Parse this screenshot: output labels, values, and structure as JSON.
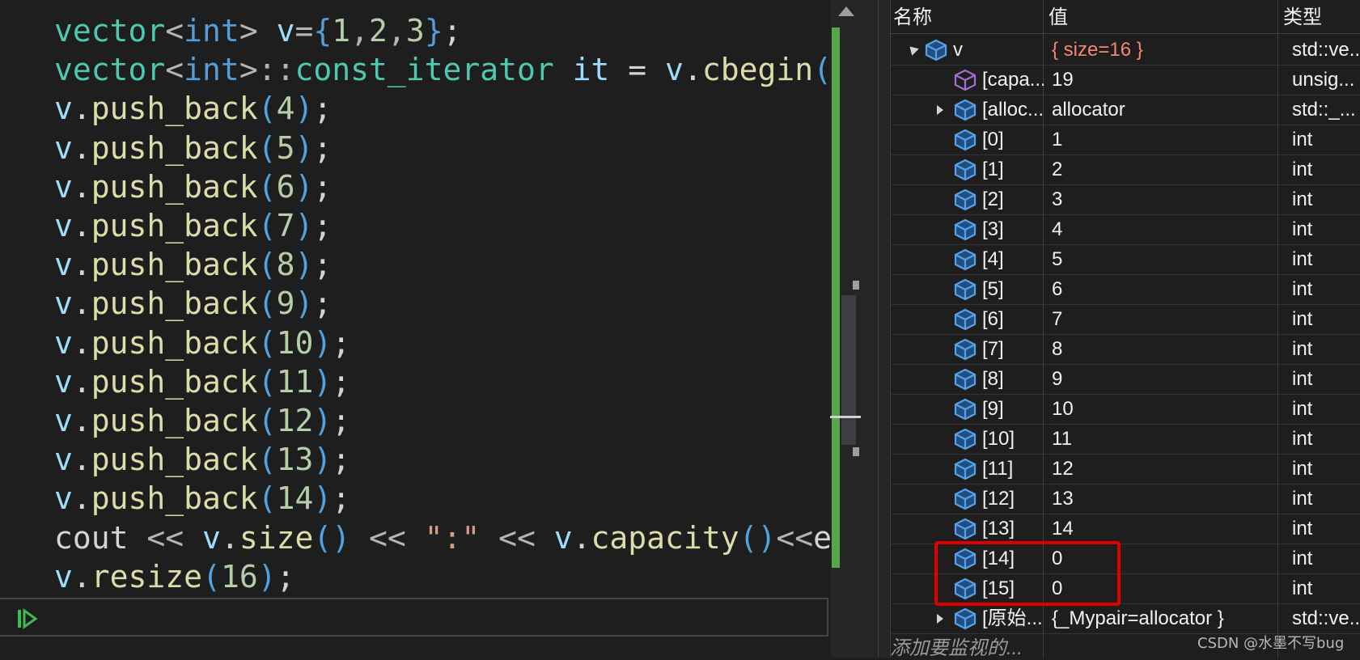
{
  "editor": {
    "lines": [
      [
        [
          "tok-type",
          "vector"
        ],
        [
          "tok-op",
          "<"
        ],
        [
          "tok-kw",
          "int"
        ],
        [
          "tok-op",
          "> "
        ],
        [
          "tok-var",
          "v"
        ],
        [
          "tok-op",
          "="
        ],
        [
          "tok-brace",
          "{"
        ],
        [
          "tok-num",
          "1"
        ],
        [
          "tok-op",
          ","
        ],
        [
          "tok-num",
          "2"
        ],
        [
          "tok-op",
          ","
        ],
        [
          "tok-num",
          "3"
        ],
        [
          "tok-brace",
          "}"
        ],
        [
          "tok-plain",
          ";"
        ]
      ],
      [
        [
          "tok-type",
          "vector"
        ],
        [
          "tok-op",
          "<"
        ],
        [
          "tok-kw",
          "int"
        ],
        [
          "tok-op",
          ">::"
        ],
        [
          "tok-type",
          "const_iterator"
        ],
        [
          "tok-plain",
          " "
        ],
        [
          "tok-var",
          "it"
        ],
        [
          "tok-plain",
          " = "
        ],
        [
          "tok-var",
          "v"
        ],
        [
          "tok-plain",
          "."
        ],
        [
          "tok-fn",
          "cbegin"
        ],
        [
          "tok-paren",
          "("
        ]
      ],
      [
        [
          "tok-var",
          "v"
        ],
        [
          "tok-plain",
          "."
        ],
        [
          "tok-fn",
          "push_back"
        ],
        [
          "tok-paren",
          "("
        ],
        [
          "tok-num",
          "4"
        ],
        [
          "tok-paren",
          ")"
        ],
        [
          "tok-plain",
          ";"
        ]
      ],
      [
        [
          "tok-var",
          "v"
        ],
        [
          "tok-plain",
          "."
        ],
        [
          "tok-fn",
          "push_back"
        ],
        [
          "tok-paren",
          "("
        ],
        [
          "tok-num",
          "5"
        ],
        [
          "tok-paren",
          ")"
        ],
        [
          "tok-plain",
          ";"
        ]
      ],
      [
        [
          "tok-var",
          "v"
        ],
        [
          "tok-plain",
          "."
        ],
        [
          "tok-fn",
          "push_back"
        ],
        [
          "tok-paren",
          "("
        ],
        [
          "tok-num",
          "6"
        ],
        [
          "tok-paren",
          ")"
        ],
        [
          "tok-plain",
          ";"
        ]
      ],
      [
        [
          "tok-var",
          "v"
        ],
        [
          "tok-plain",
          "."
        ],
        [
          "tok-fn",
          "push_back"
        ],
        [
          "tok-paren",
          "("
        ],
        [
          "tok-num",
          "7"
        ],
        [
          "tok-paren",
          ")"
        ],
        [
          "tok-plain",
          ";"
        ]
      ],
      [
        [
          "tok-var",
          "v"
        ],
        [
          "tok-plain",
          "."
        ],
        [
          "tok-fn",
          "push_back"
        ],
        [
          "tok-paren",
          "("
        ],
        [
          "tok-num",
          "8"
        ],
        [
          "tok-paren",
          ")"
        ],
        [
          "tok-plain",
          ";"
        ]
      ],
      [
        [
          "tok-var",
          "v"
        ],
        [
          "tok-plain",
          "."
        ],
        [
          "tok-fn",
          "push_back"
        ],
        [
          "tok-paren",
          "("
        ],
        [
          "tok-num",
          "9"
        ],
        [
          "tok-paren",
          ")"
        ],
        [
          "tok-plain",
          ";"
        ]
      ],
      [
        [
          "tok-var",
          "v"
        ],
        [
          "tok-plain",
          "."
        ],
        [
          "tok-fn",
          "push_back"
        ],
        [
          "tok-paren",
          "("
        ],
        [
          "tok-num",
          "10"
        ],
        [
          "tok-paren",
          ")"
        ],
        [
          "tok-plain",
          ";"
        ]
      ],
      [
        [
          "tok-var",
          "v"
        ],
        [
          "tok-plain",
          "."
        ],
        [
          "tok-fn",
          "push_back"
        ],
        [
          "tok-paren",
          "("
        ],
        [
          "tok-num",
          "11"
        ],
        [
          "tok-paren",
          ")"
        ],
        [
          "tok-plain",
          ";"
        ]
      ],
      [
        [
          "tok-var",
          "v"
        ],
        [
          "tok-plain",
          "."
        ],
        [
          "tok-fn",
          "push_back"
        ],
        [
          "tok-paren",
          "("
        ],
        [
          "tok-num",
          "12"
        ],
        [
          "tok-paren",
          ")"
        ],
        [
          "tok-plain",
          ";"
        ]
      ],
      [
        [
          "tok-var",
          "v"
        ],
        [
          "tok-plain",
          "."
        ],
        [
          "tok-fn",
          "push_back"
        ],
        [
          "tok-paren",
          "("
        ],
        [
          "tok-num",
          "13"
        ],
        [
          "tok-paren",
          ")"
        ],
        [
          "tok-plain",
          ";"
        ]
      ],
      [
        [
          "tok-var",
          "v"
        ],
        [
          "tok-plain",
          "."
        ],
        [
          "tok-fn",
          "push_back"
        ],
        [
          "tok-paren",
          "("
        ],
        [
          "tok-num",
          "14"
        ],
        [
          "tok-paren",
          ")"
        ],
        [
          "tok-plain",
          ";"
        ]
      ],
      [
        [
          "tok-plain",
          "cout "
        ],
        [
          "tok-dim",
          "<< "
        ],
        [
          "tok-var",
          "v"
        ],
        [
          "tok-plain",
          "."
        ],
        [
          "tok-fn",
          "size"
        ],
        [
          "tok-paren",
          "()"
        ],
        [
          "tok-dim",
          " << "
        ],
        [
          "tok-str",
          "\":\""
        ],
        [
          "tok-dim",
          " << "
        ],
        [
          "tok-var",
          "v"
        ],
        [
          "tok-plain",
          "."
        ],
        [
          "tok-fn",
          "capacity"
        ],
        [
          "tok-paren",
          "()"
        ],
        [
          "tok-dim",
          "<<"
        ],
        [
          "tok-plain",
          "e"
        ]
      ],
      [
        [
          "tok-var",
          "v"
        ],
        [
          "tok-plain",
          "."
        ],
        [
          "tok-fn",
          "resize"
        ],
        [
          "tok-paren",
          "("
        ],
        [
          "tok-num",
          "16"
        ],
        [
          "tok-paren",
          ")"
        ],
        [
          "tok-plain",
          ";"
        ]
      ]
    ]
  },
  "watch": {
    "headers": {
      "name": "名称",
      "value": "值",
      "type": "类型"
    },
    "rows": [
      {
        "name": "v",
        "value": "{ size=16 }",
        "type": "std::ve...",
        "expander": "open",
        "icon": "object-icon",
        "indent": 0,
        "changed": true
      },
      {
        "name": "[capa...",
        "value": "19",
        "type": "unsig...",
        "expander": "none",
        "icon": "field-icon",
        "indent": 1,
        "changed": false
      },
      {
        "name": "[alloc...",
        "value": "allocator",
        "type": "std::_...",
        "expander": "closed",
        "icon": "object-icon",
        "indent": 1,
        "changed": false
      },
      {
        "name": "[0]",
        "value": "1",
        "type": "int",
        "expander": "none",
        "icon": "object-icon",
        "indent": 1,
        "changed": false
      },
      {
        "name": "[1]",
        "value": "2",
        "type": "int",
        "expander": "none",
        "icon": "object-icon",
        "indent": 1,
        "changed": false
      },
      {
        "name": "[2]",
        "value": "3",
        "type": "int",
        "expander": "none",
        "icon": "object-icon",
        "indent": 1,
        "changed": false
      },
      {
        "name": "[3]",
        "value": "4",
        "type": "int",
        "expander": "none",
        "icon": "object-icon",
        "indent": 1,
        "changed": false
      },
      {
        "name": "[4]",
        "value": "5",
        "type": "int",
        "expander": "none",
        "icon": "object-icon",
        "indent": 1,
        "changed": false
      },
      {
        "name": "[5]",
        "value": "6",
        "type": "int",
        "expander": "none",
        "icon": "object-icon",
        "indent": 1,
        "changed": false
      },
      {
        "name": "[6]",
        "value": "7",
        "type": "int",
        "expander": "none",
        "icon": "object-icon",
        "indent": 1,
        "changed": false
      },
      {
        "name": "[7]",
        "value": "8",
        "type": "int",
        "expander": "none",
        "icon": "object-icon",
        "indent": 1,
        "changed": false
      },
      {
        "name": "[8]",
        "value": "9",
        "type": "int",
        "expander": "none",
        "icon": "object-icon",
        "indent": 1,
        "changed": false
      },
      {
        "name": "[9]",
        "value": "10",
        "type": "int",
        "expander": "none",
        "icon": "object-icon",
        "indent": 1,
        "changed": false
      },
      {
        "name": "[10]",
        "value": "11",
        "type": "int",
        "expander": "none",
        "icon": "object-icon",
        "indent": 1,
        "changed": false
      },
      {
        "name": "[11]",
        "value": "12",
        "type": "int",
        "expander": "none",
        "icon": "object-icon",
        "indent": 1,
        "changed": false
      },
      {
        "name": "[12]",
        "value": "13",
        "type": "int",
        "expander": "none",
        "icon": "object-icon",
        "indent": 1,
        "changed": false
      },
      {
        "name": "[13]",
        "value": "14",
        "type": "int",
        "expander": "none",
        "icon": "object-icon",
        "indent": 1,
        "changed": false
      },
      {
        "name": "[14]",
        "value": "0",
        "type": "int",
        "expander": "none",
        "icon": "object-icon",
        "indent": 1,
        "changed": false
      },
      {
        "name": "[15]",
        "value": "0",
        "type": "int",
        "expander": "none",
        "icon": "object-icon",
        "indent": 1,
        "changed": false
      },
      {
        "name": "[原始...",
        "value": "{_Mypair=allocator }",
        "type": "std::ve...",
        "expander": "closed",
        "icon": "object-icon",
        "indent": 1,
        "changed": false
      }
    ],
    "add_watch_placeholder": "添加要监视的...",
    "highlight_color": "#e00000"
  },
  "watermark": "CSDN @水墨不写bug",
  "colors": {
    "editor_bg": "#1e1e1e",
    "change_bar": "#57a64a",
    "changed_value": "#f48771"
  }
}
